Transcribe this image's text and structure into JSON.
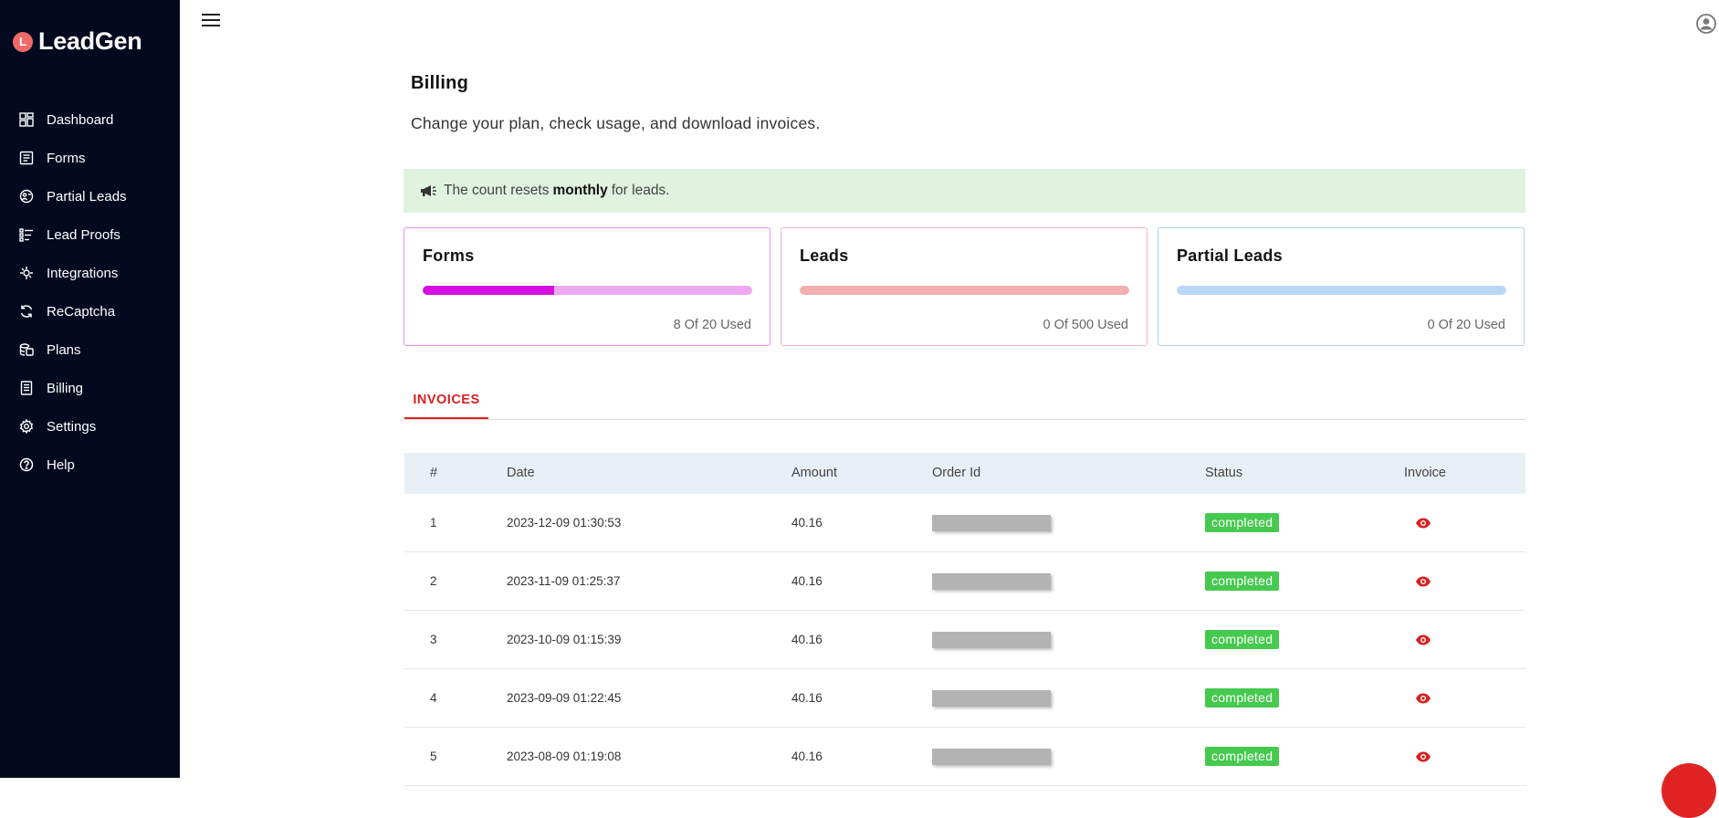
{
  "app": {
    "name": "LeadGen",
    "logo_letter": "L",
    "brand_color": "#f06a6a",
    "sidebar_bg": "#030a1f"
  },
  "sidebar": {
    "items": [
      {
        "label": "Dashboard",
        "icon": "dashboard-icon"
      },
      {
        "label": "Forms",
        "icon": "forms-icon"
      },
      {
        "label": "Partial Leads",
        "icon": "partial-leads-icon"
      },
      {
        "label": "Lead Proofs",
        "icon": "lead-proofs-icon"
      },
      {
        "label": "Integrations",
        "icon": "integrations-icon"
      },
      {
        "label": "ReCaptcha",
        "icon": "recaptcha-icon"
      },
      {
        "label": "Plans",
        "icon": "plans-icon"
      },
      {
        "label": "Billing",
        "icon": "billing-icon"
      },
      {
        "label": "Settings",
        "icon": "gear-icon"
      },
      {
        "label": "Help",
        "icon": "help-icon"
      }
    ]
  },
  "page": {
    "title": "Billing",
    "subtitle": "Change your plan, check usage, and download invoices."
  },
  "notice": {
    "prefix": "The count resets",
    "bold": "monthly",
    "suffix": "for leads.",
    "icon": "megaphone-icon"
  },
  "usage_cards": [
    {
      "title": "Forms",
      "usage_text": "8 Of 20 Used",
      "used": 8,
      "total": 20,
      "fill_color": "#d40fe0",
      "track_color": "#eea9f3",
      "border_color": "#ef8cf5"
    },
    {
      "title": "Leads",
      "usage_text": "0 Of 500 Used",
      "used": 0,
      "total": 500,
      "fill_color": "#e05555",
      "track_color": "#f2b0b0",
      "border_color": "#f5b3be"
    },
    {
      "title": "Partial Leads",
      "usage_text": "0 Of 20 Used",
      "used": 0,
      "total": 20,
      "fill_color": "#4a90e2",
      "track_color": "#b9d8f7",
      "border_color": "#a9d3f5"
    }
  ],
  "tabs": {
    "active": "INVOICES"
  },
  "invoices": {
    "headers": [
      "#",
      "Date",
      "Amount",
      "Order Id",
      "Status",
      "Invoice"
    ],
    "rows": [
      {
        "num": "1",
        "date": "2023-12-09 01:30:53",
        "amount": "40.16",
        "status": "completed"
      },
      {
        "num": "2",
        "date": "2023-11-09 01:25:37",
        "amount": "40.16",
        "status": "completed"
      },
      {
        "num": "3",
        "date": "2023-10-09 01:15:39",
        "amount": "40.16",
        "status": "completed"
      },
      {
        "num": "4",
        "date": "2023-09-09 01:22:45",
        "amount": "40.16",
        "status": "completed"
      },
      {
        "num": "5",
        "date": "2023-08-09 01:19:08",
        "amount": "40.16",
        "status": "completed"
      }
    ],
    "status_color": "#46c94f",
    "view_icon": "eye-icon",
    "view_icon_color": "#d92121"
  }
}
